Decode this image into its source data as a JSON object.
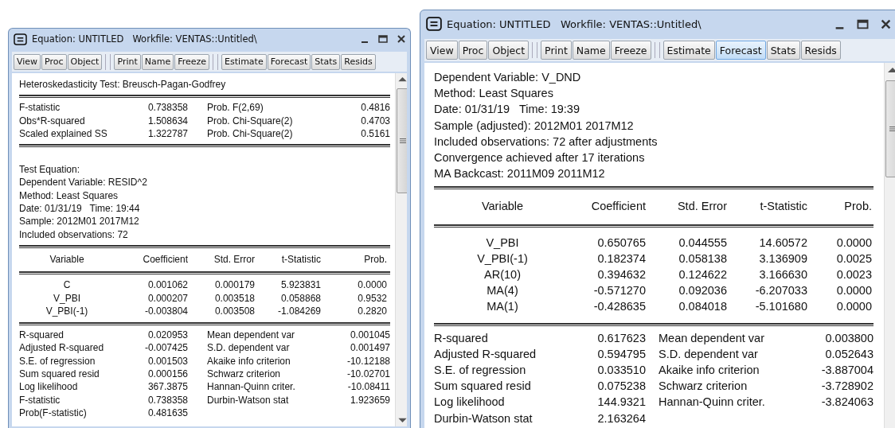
{
  "windows": [
    {
      "title": "Equation: UNTITLED   Workfile: VENTAS::Untitled\\",
      "toolbar": [
        [
          {
            "label": "View",
            "selected": false
          },
          {
            "label": "Proc",
            "selected": false
          },
          {
            "label": "Object",
            "selected": false
          }
        ],
        [
          {
            "label": "Print",
            "selected": false
          },
          {
            "label": "Name",
            "selected": false
          },
          {
            "label": "Freeze",
            "selected": false
          }
        ],
        [
          {
            "label": "Estimate",
            "selected": false
          },
          {
            "label": "Forecast",
            "selected": false
          },
          {
            "label": "Stats",
            "selected": false
          },
          {
            "label": "Resids",
            "selected": false
          }
        ]
      ],
      "output": [
        {
          "kind": "lines",
          "lines": [
            "Heteroskedasticity Test: Breusch-Pagan-Godfrey"
          ]
        },
        {
          "kind": "pairs",
          "rows": [
            [
              "F-statistic",
              "0.738358",
              "Prob. F(2,69)",
              "0.4816"
            ],
            [
              "Obs*R-squared",
              "1.508634",
              "Prob. Chi-Square(2)",
              "0.4703"
            ],
            [
              "Scaled explained SS",
              "1.322787",
              "Prob. Chi-Square(2)",
              "0.5161"
            ]
          ]
        },
        {
          "kind": "lines",
          "lines": [
            "Test Equation:",
            "Dependent Variable: RESID^2",
            "Method: Least Squares",
            "Date: 01/31/19   Time: 19:44",
            "Sample: 2012M01 2017M12",
            "Included observations: 72"
          ]
        },
        {
          "kind": "table",
          "columns": [
            "Variable",
            "Coefficient",
            "Std. Error",
            "t-Statistic",
            "Prob."
          ],
          "rows": [
            [
              "C",
              "0.001062",
              "0.000179",
              "5.923831",
              "0.0000"
            ],
            [
              "V_PBI",
              "0.000207",
              "0.003518",
              "0.058868",
              "0.9532"
            ],
            [
              "V_PBI(-1)",
              "-0.003804",
              "0.003508",
              "-1.084269",
              "0.2820"
            ]
          ]
        },
        {
          "kind": "pairs",
          "rows": [
            [
              "R-squared",
              "0.020953",
              "Mean dependent var",
              "0.001045"
            ],
            [
              "Adjusted R-squared",
              "-0.007425",
              "S.D. dependent var",
              "0.001497"
            ],
            [
              "S.E. of regression",
              "0.001503",
              "Akaike info criterion",
              "-10.12188"
            ],
            [
              "Sum squared resid",
              "0.000156",
              "Schwarz criterion",
              "-10.02701"
            ],
            [
              "Log likelihood",
              "367.3875",
              "Hannan-Quinn criter.",
              "-10.08411"
            ],
            [
              "F-statistic",
              "0.738358",
              "Durbin-Watson stat",
              "1.923659"
            ],
            [
              "Prob(F-statistic)",
              "0.481635"
            ]
          ]
        }
      ]
    },
    {
      "title": "Equation: UNTITLED   Workfile: VENTAS::Untitled\\",
      "toolbar": [
        [
          {
            "label": "View",
            "selected": false
          },
          {
            "label": "Proc",
            "selected": false
          },
          {
            "label": "Object",
            "selected": false
          }
        ],
        [
          {
            "label": "Print",
            "selected": false
          },
          {
            "label": "Name",
            "selected": false
          },
          {
            "label": "Freeze",
            "selected": false
          }
        ],
        [
          {
            "label": "Estimate",
            "selected": false
          },
          {
            "label": "Forecast",
            "selected": true
          },
          {
            "label": "Stats",
            "selected": false
          },
          {
            "label": "Resids",
            "selected": false
          }
        ]
      ],
      "output": [
        {
          "kind": "lines",
          "lines": [
            "Dependent Variable: V_DND",
            "Method: Least Squares",
            "Date: 01/31/19   Time: 19:39",
            "Sample (adjusted): 2012M01 2017M12",
            "Included observations: 72 after adjustments",
            "Convergence achieved after 17 iterations",
            "MA Backcast: 2011M09 2011M12"
          ]
        },
        {
          "kind": "table",
          "columns": [
            "Variable",
            "Coefficient",
            "Std. Error",
            "t-Statistic",
            "Prob."
          ],
          "rows": [
            [
              "V_PBI",
              "0.650765",
              "0.044555",
              "14.60572",
              "0.0000"
            ],
            [
              "V_PBI(-1)",
              "0.182374",
              "0.058138",
              "3.136909",
              "0.0025"
            ],
            [
              "AR(10)",
              "0.394632",
              "0.124622",
              "3.166630",
              "0.0023"
            ],
            [
              "MA(4)",
              "-0.571270",
              "0.092036",
              "-6.207033",
              "0.0000"
            ],
            [
              "MA(1)",
              "-0.428635",
              "0.084018",
              "-5.101680",
              "0.0000"
            ]
          ]
        },
        {
          "kind": "pairs",
          "rows": [
            [
              "R-squared",
              "0.617623",
              "Mean dependent var",
              "0.003800"
            ],
            [
              "Adjusted R-squared",
              "0.594795",
              "S.D. dependent var",
              "0.052643"
            ],
            [
              "S.E. of regression",
              "0.033510",
              "Akaike info criterion",
              "-3.887004"
            ],
            [
              "Sum squared resid",
              "0.075238",
              "Schwarz criterion",
              "-3.728902"
            ],
            [
              "Log likelihood",
              "144.9321",
              "Hannan-Quinn criter.",
              "-3.824063"
            ],
            [
              "Durbin-Watson stat",
              "2.163264"
            ]
          ]
        }
      ]
    }
  ]
}
